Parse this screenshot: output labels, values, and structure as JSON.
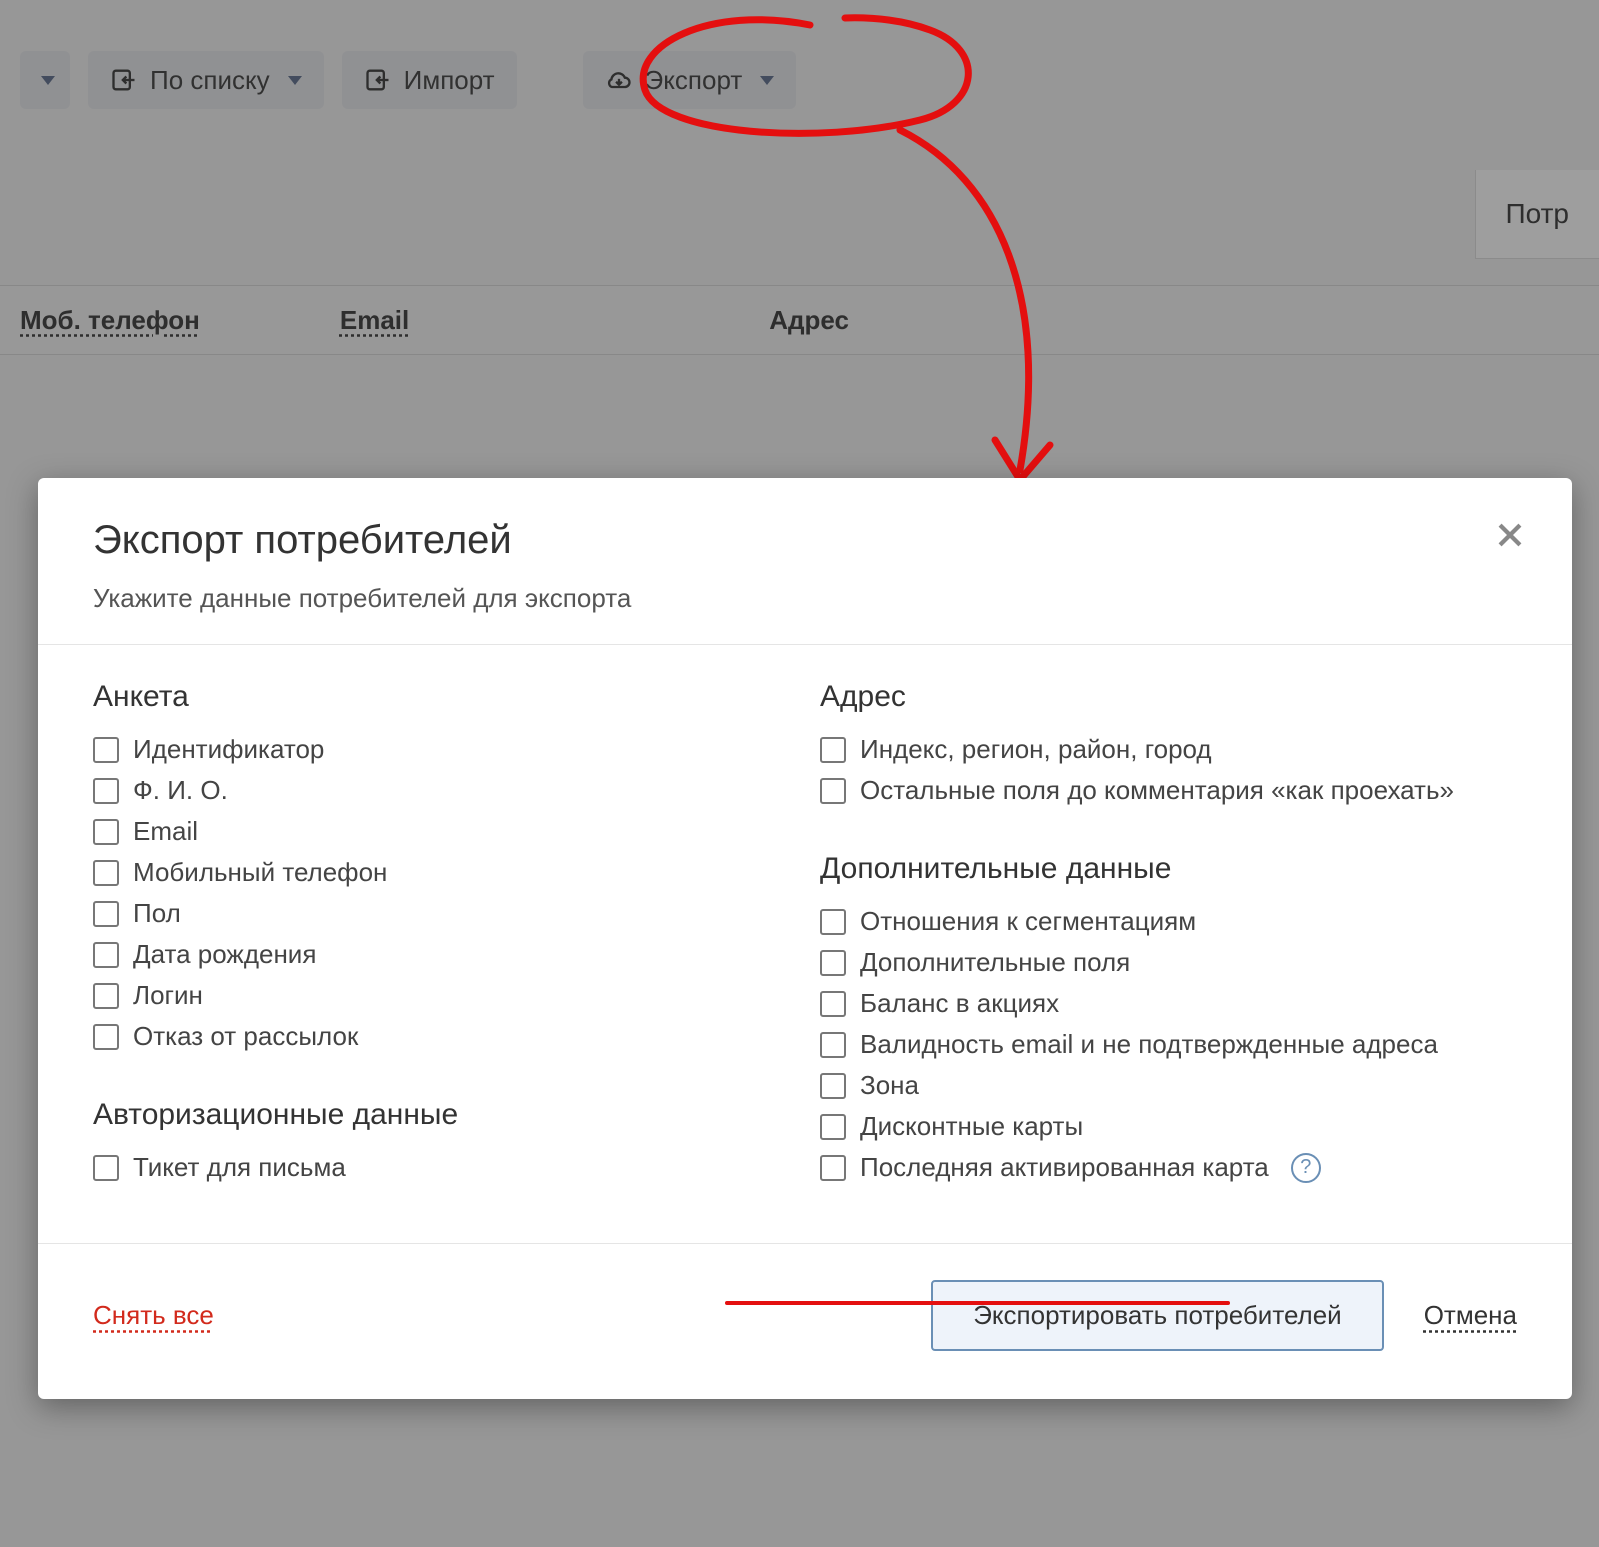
{
  "toolbar": {
    "byList": "По списку",
    "import": "Импорт",
    "export": "Экспорт"
  },
  "background": {
    "tab_truncated": "Потр",
    "columns": {
      "mob": "Моб. телефон",
      "email": "Email",
      "address": "Адрес"
    }
  },
  "modal": {
    "title": "Экспорт потребителей",
    "subtitle": "Укажите данные потребителей для экспорта",
    "sections": {
      "anketa": {
        "title": "Анкета",
        "items": [
          "Идентификатор",
          "Ф. И. О.",
          "Email",
          "Мобильный телефон",
          "Пол",
          "Дата рождения",
          "Логин",
          "Отказ от рассылок"
        ]
      },
      "auth": {
        "title": "Авторизационные данные",
        "items": [
          "Тикет для письма"
        ]
      },
      "address": {
        "title": "Адрес",
        "items": [
          "Индекс, регион, район, город",
          "Остальные поля до комментария «как проехать»"
        ]
      },
      "extra": {
        "title": "Дополнительные данные",
        "items": [
          "Отношения к сегментациям",
          "Дополнительные поля",
          "Баланс в акциях",
          "Валидность email и не подтвержденные адреса",
          "Зона",
          "Дисконтные карты",
          "Последняя активированная карта"
        ]
      }
    },
    "footer": {
      "clearAll": "Снять все",
      "submit": "Экспортировать потребителей",
      "cancel": "Отмена"
    },
    "help_glyph": "?"
  },
  "annotations": {
    "highlight_item": "Последняя активированная карта",
    "circled_button": "Экспорт"
  }
}
